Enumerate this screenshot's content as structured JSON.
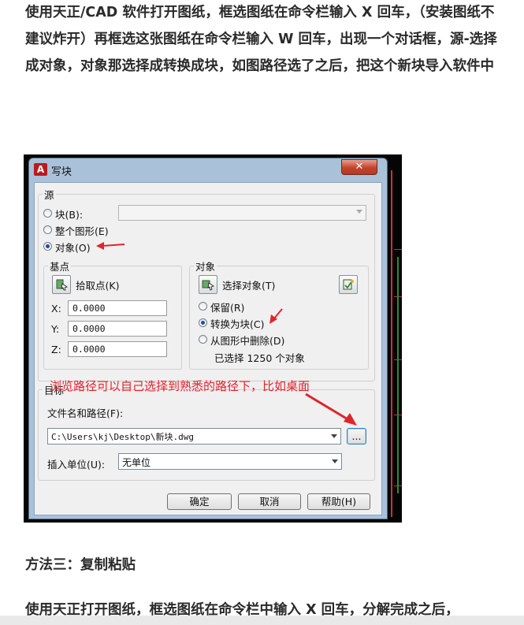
{
  "article": {
    "para1": "使用天正/CAD 软件打开图纸，框选图纸在命令栏输入 X 回车，（安装图纸不建议炸开）再框选这张图纸在命令栏输入 W 回车，出现一个对话框，源-选择成对象，对象那选择成转换成块，如图路径选了之后，把这个新块导入软件中",
    "method3_title": "方法三：复制粘贴",
    "para2": "使用天正打开图纸，框选图纸在命令栏中输入 X 回车，分解完成之后，"
  },
  "dialog": {
    "title": "写块",
    "app_icon_text": "A",
    "close_symbol": "✕",
    "source": {
      "group_label": "源",
      "radio_block": "块(B):",
      "radio_whole": "整个图形(E)",
      "radio_object": "对象(O)",
      "selected": "对象(O)",
      "block_combo_value": ""
    },
    "base_point": {
      "group_label": "基点",
      "pick_label": "拾取点(K)",
      "x_label": "X:",
      "x_value": "0.0000",
      "y_label": "Y:",
      "y_value": "0.0000",
      "z_label": "Z:",
      "z_value": "0.0000"
    },
    "objects": {
      "group_label": "对象",
      "select_label": "选择对象(T)",
      "radio_retain": "保留(R)",
      "radio_convert": "转换为块(C)",
      "radio_delete": "从图形中删除(D)",
      "selected": "转换为块(C)",
      "selected_count_text": "已选择 1250 个对象"
    },
    "destination": {
      "group_label": "目标",
      "file_label": "文件名和路径(F):",
      "file_path": "C:\\Users\\kj\\Desktop\\新块.dwg",
      "browse_label": "...",
      "units_label": "插入单位(U):",
      "units_value": "无单位"
    },
    "buttons": {
      "ok": "确定",
      "cancel": "取消",
      "help": "帮助(H)"
    }
  },
  "annotation": {
    "text": "浏览路径可以自己选择到熟悉的路径下，比如桌面",
    "color": "#e0242c"
  },
  "colors": {
    "dialog_frame": "#a9c1d9",
    "cad_background": "#050505",
    "cad_lines": "#c8323a"
  }
}
